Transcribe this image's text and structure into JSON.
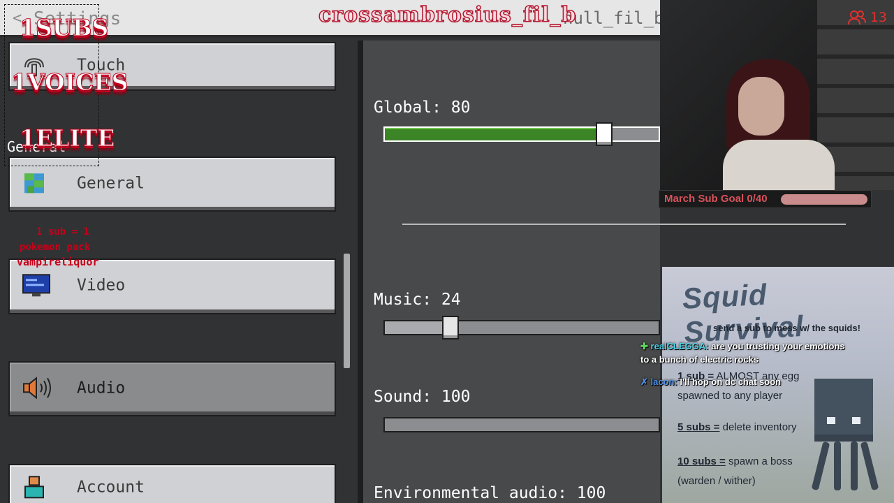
{
  "header": {
    "back_glyph": "<",
    "title": "Settings",
    "streamer_name": "crossambrosius_fil_b",
    "faded_name": "hull_fil_b"
  },
  "sidebar": {
    "group_label": "General",
    "items": [
      {
        "label": "Touch",
        "icon": "touch-hand-icon"
      },
      {
        "label": "General",
        "icon": "grass-globe-icon"
      },
      {
        "label": "Video",
        "icon": "monitor-icon"
      },
      {
        "label": "Audio",
        "icon": "speaker-icon",
        "selected": true
      },
      {
        "label": "Account",
        "icon": "person-icon"
      }
    ]
  },
  "audio": {
    "global": {
      "label": "Global: 80",
      "value": 80
    },
    "music": {
      "label": "Music: 24",
      "value": 24
    },
    "sound": {
      "label": "Sound: 100",
      "value": 100
    },
    "environmental": {
      "label": "Environmental audio: 100",
      "value": 100
    }
  },
  "overlays": {
    "subs": "1SUBS",
    "voices": "1VOICES",
    "elite": "1ELITE",
    "pokemon_1": "1 sub = 1",
    "pokemon_2": "pokemon pack",
    "pokemon_3": "vampireliquor"
  },
  "webcam": {
    "viewer_count": "13"
  },
  "sub_goal": {
    "label": "March Sub Goal 0/40",
    "current": 0,
    "target": 40
  },
  "squid_panel": {
    "title": "Squid Survival",
    "subtitle": "send a sub to mess w/ the squids!",
    "rules": [
      {
        "count": "1 sub =",
        "text": "ALMOST any egg",
        "line2": "spawned to any player"
      },
      {
        "count": "5 subs =",
        "text": "delete inventory"
      },
      {
        "count": "10 subs =",
        "text": "spawn a boss",
        "line2": "(warden / wither)"
      }
    ]
  },
  "chat": [
    {
      "user": "realCLEGGA:",
      "message": "are you trusting your emotions",
      "message2": "to a bunch of electric rocks"
    },
    {
      "user": "lacon:",
      "message": "I'll hop on dc chat soon"
    }
  ],
  "colors": {
    "slider_fill": "#3c8527",
    "overlay_red": "#c0001d",
    "sub_goal_red": "#d8525b",
    "viewer_red": "#e0312f"
  }
}
